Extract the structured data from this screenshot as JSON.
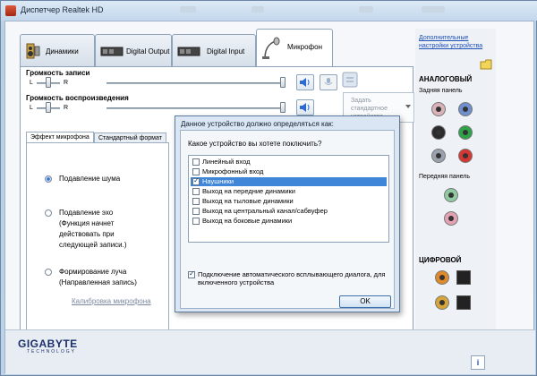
{
  "window": {
    "title": "Диспетчер Realtek HD"
  },
  "tabs": [
    {
      "label": "Динамики"
    },
    {
      "label": "Digital Output"
    },
    {
      "label": "Digital Input"
    },
    {
      "label": "Микрофон"
    }
  ],
  "record_volume": {
    "label": "Громкость записи",
    "left": "L",
    "right": "R"
  },
  "playback_volume": {
    "label": "Громкость воспроизведения",
    "left": "L",
    "right": "R"
  },
  "default_device": {
    "label": "Задать стандартное устройство"
  },
  "inner_tabs": [
    {
      "label": "Эффект микрофона"
    },
    {
      "label": "Стандартный формат"
    }
  ],
  "effects": [
    {
      "label": "Подавление шума",
      "selected": true
    },
    {
      "label": "Подавление эхо\n(Функция начнет\nдействовать при\nследующей записи.)",
      "selected": false
    },
    {
      "label": "Формирование луча\n(Направленная запись)",
      "selected": false
    }
  ],
  "calibration_link": "Калибровка микрофона",
  "right_panel": {
    "advanced_link": "Дополнительные настройки устройства",
    "analog_heading": "АНАЛОГОВЫЙ",
    "rear_panel": "Задняя панель",
    "front_panel": "Передняя панель",
    "digital_heading": "ЦИФРОВОЙ"
  },
  "brand": {
    "name": "GIGABYTE",
    "tagline": "TECHNOLOGY"
  },
  "dialog": {
    "title": "Данное устройство должно определяться как:",
    "question": "Какое устройство вы хотете поключить?",
    "items": [
      {
        "label": "Линейный вход",
        "checked": false,
        "selected": false
      },
      {
        "label": "Микрофонный вход",
        "checked": false,
        "selected": false
      },
      {
        "label": "Наушники",
        "checked": true,
        "selected": true
      },
      {
        "label": "Выход на передние динамики",
        "checked": false,
        "selected": false
      },
      {
        "label": "Выход на тыловые динамики",
        "checked": false,
        "selected": false
      },
      {
        "label": "Выход на центральный канал/сабвуфер",
        "checked": false,
        "selected": false
      },
      {
        "label": "Выход на боковые динамики",
        "checked": false,
        "selected": false
      }
    ],
    "auto_popup": "Подключение автоматического всплывающего диалога, для включенного устройства",
    "ok_label": "OK"
  },
  "info_label": "i",
  "colors": {
    "jack_rear": [
      "#d9b3b8",
      "#6f8fcf",
      "#2b2b2b",
      "#2fa34a",
      "#9aa3ad",
      "#d83535"
    ],
    "jack_front": [
      "#8fc9a0",
      "#e2a2b4"
    ]
  }
}
